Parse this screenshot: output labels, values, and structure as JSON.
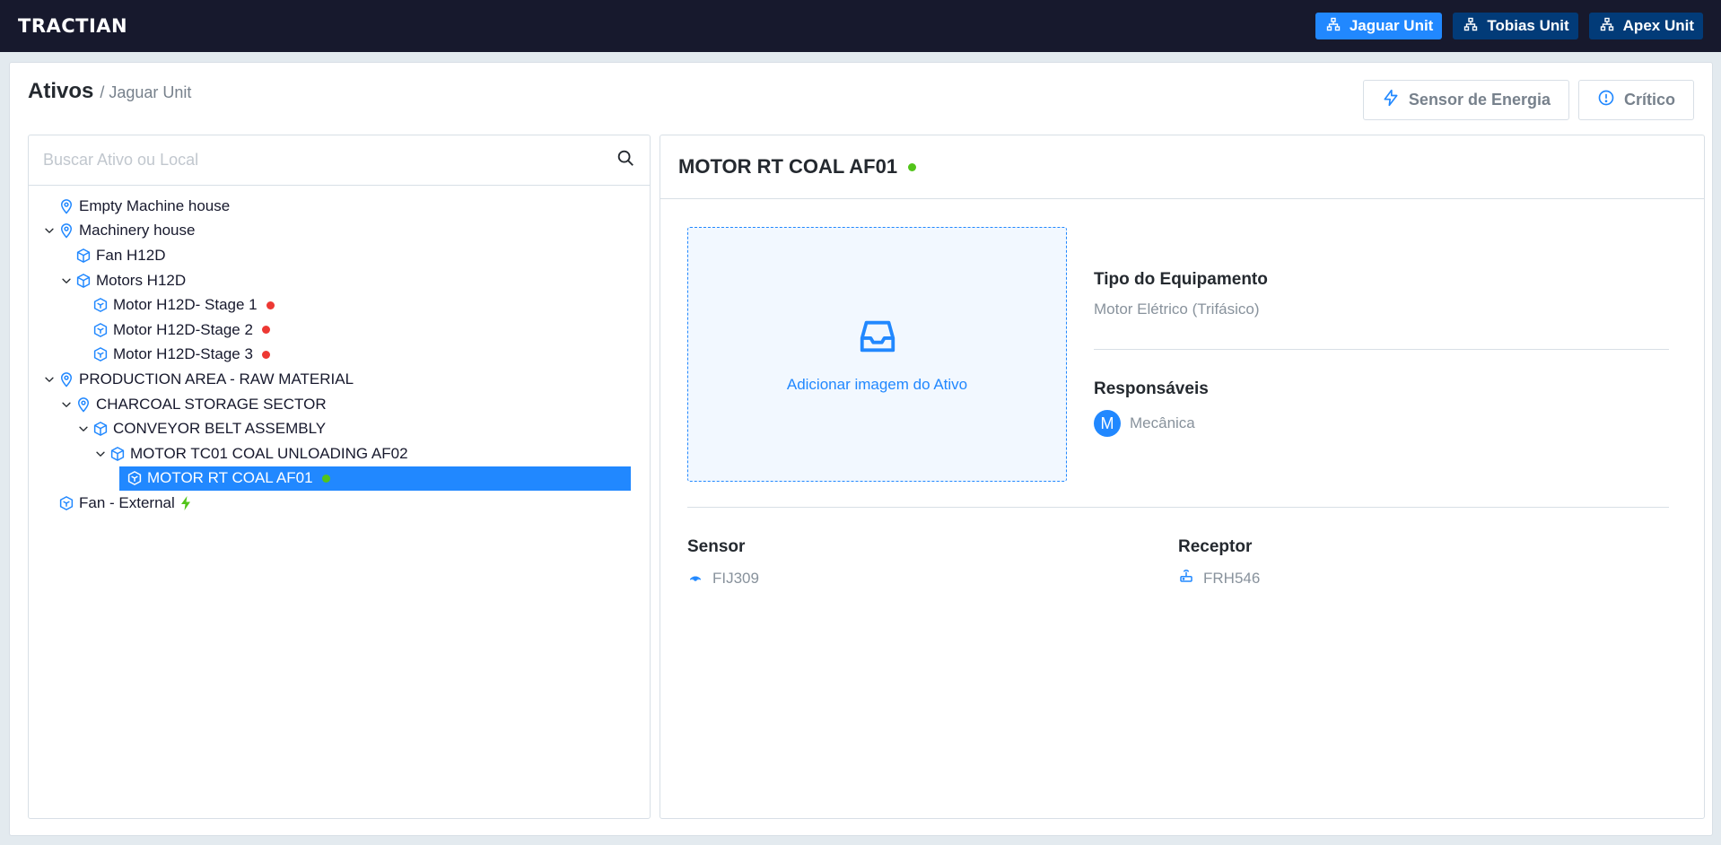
{
  "brand": {
    "logo": "TRACTIAN"
  },
  "units": [
    {
      "label": "Jaguar Unit",
      "active": true
    },
    {
      "label": "Tobias Unit",
      "active": false
    },
    {
      "label": "Apex Unit",
      "active": false
    }
  ],
  "page": {
    "title": "Ativos",
    "breadcrumb": "/ Jaguar Unit"
  },
  "filters": {
    "energy_label": "Sensor de Energia",
    "critical_label": "Crítico"
  },
  "search": {
    "placeholder": "Buscar Ativo ou Local"
  },
  "tree": [
    {
      "label": "Empty Machine house",
      "type": "location",
      "depth": 0,
      "expanded": null,
      "status": null
    },
    {
      "label": "Machinery house",
      "type": "location",
      "depth": 0,
      "expanded": true,
      "status": null
    },
    {
      "label": "Fan H12D",
      "type": "asset",
      "depth": 1,
      "expanded": null,
      "status": null
    },
    {
      "label": "Motors H12D",
      "type": "asset",
      "depth": 1,
      "expanded": true,
      "status": null
    },
    {
      "label": "Motor H12D- Stage 1",
      "type": "component",
      "depth": 2,
      "expanded": null,
      "status": "alert"
    },
    {
      "label": "Motor H12D-Stage 2",
      "type": "component",
      "depth": 2,
      "expanded": null,
      "status": "alert"
    },
    {
      "label": "Motor H12D-Stage 3",
      "type": "component",
      "depth": 2,
      "expanded": null,
      "status": "alert"
    },
    {
      "label": "PRODUCTION AREA - RAW MATERIAL",
      "type": "location",
      "depth": 0,
      "expanded": true,
      "status": null
    },
    {
      "label": "CHARCOAL STORAGE SECTOR",
      "type": "location",
      "depth": 1,
      "expanded": true,
      "status": null
    },
    {
      "label": "CONVEYOR BELT ASSEMBLY",
      "type": "asset",
      "depth": 2,
      "expanded": true,
      "status": null
    },
    {
      "label": "MOTOR TC01 COAL UNLOADING AF02",
      "type": "asset",
      "depth": 3,
      "expanded": true,
      "status": null
    },
    {
      "label": "MOTOR RT COAL AF01",
      "type": "component",
      "depth": 4,
      "expanded": null,
      "status": "operating",
      "selected": true
    },
    {
      "label": "Fan - External",
      "type": "component",
      "depth": 0,
      "expanded": null,
      "status": "energy"
    }
  ],
  "detail": {
    "title": "MOTOR RT COAL AF01",
    "status": "operating",
    "upload_label": "Adicionar imagem do Ativo",
    "equipment_type_label": "Tipo do Equipamento",
    "equipment_type_value": "Motor Elétrico (Trifásico)",
    "responsibles_label": "Responsáveis",
    "responsible_initial": "M",
    "responsible_name": "Mecânica",
    "sensor_label": "Sensor",
    "sensor_value": "FIJ309",
    "receiver_label": "Receptor",
    "receiver_value": "FRH546"
  },
  "colors": {
    "primary": "#2188ff",
    "topbar": "#17192d",
    "unit_inactive": "#023b78",
    "alert": "#ed3833",
    "operating": "#52c41a"
  },
  "icons": {
    "unit": "unit-tree-icon",
    "location": "location-pin-icon",
    "asset": "cube-icon",
    "component": "component-cube-icon",
    "energy": "lightning-bolt-icon"
  }
}
